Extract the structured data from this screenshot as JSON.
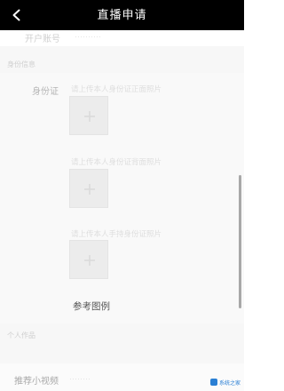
{
  "header": {
    "title": "直播申请",
    "back_icon": "chevron-left-icon"
  },
  "faded_row": {
    "label": "开户账号",
    "value": "··········"
  },
  "sections": {
    "identity_label": "身份信息",
    "works_label": "个人作品"
  },
  "identity": {
    "label": "身份证",
    "uploads": [
      {
        "hint": "请上传本人身份证正面照片"
      },
      {
        "hint": "请上传本人身份证背面照片"
      },
      {
        "hint": "请上传本人手持身份证照片"
      }
    ],
    "reference_link": "参考图例"
  },
  "works": {
    "label": "推荐小视频",
    "value": "········"
  },
  "watermark": {
    "text": "系统之家"
  },
  "colors": {
    "header_bg": "#000000",
    "header_text": "#ffffff",
    "page_bg": "#f7f7f7"
  }
}
